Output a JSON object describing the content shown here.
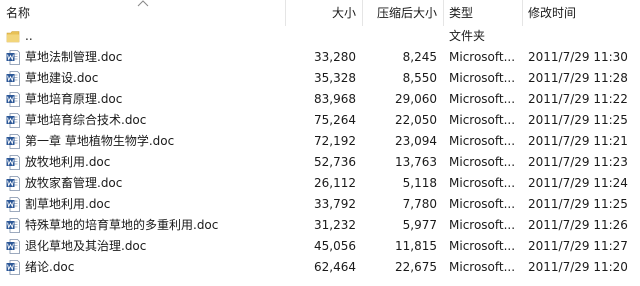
{
  "columns": {
    "name": "名称",
    "size": "大小",
    "compressed": "压缩后大小",
    "type": "类型",
    "modified": "修改时间"
  },
  "parent_row": {
    "name": "..",
    "type": "文件夹",
    "icon": "folder-icon"
  },
  "file_icon": "word-doc-icon",
  "colors": {
    "folder": "#e8c156",
    "word_blue": "#2b5797",
    "separator": "#e5e5e5"
  },
  "files": [
    {
      "name": "草地法制管理.doc",
      "size": "33,280",
      "compressed": "8,245",
      "type": "Microsoft...",
      "modified": "2011/7/29 11:30"
    },
    {
      "name": "草地建设.doc",
      "size": "35,328",
      "compressed": "8,550",
      "type": "Microsoft...",
      "modified": "2011/7/29 11:28"
    },
    {
      "name": "草地培育原理.doc",
      "size": "83,968",
      "compressed": "29,060",
      "type": "Microsoft...",
      "modified": "2011/7/29 11:22"
    },
    {
      "name": "草地培育综合技术.doc",
      "size": "75,264",
      "compressed": "22,050",
      "type": "Microsoft...",
      "modified": "2011/7/29 11:25"
    },
    {
      "name": "第一章 草地植物生物学.doc",
      "size": "72,192",
      "compressed": "23,094",
      "type": "Microsoft...",
      "modified": "2011/7/29 11:21"
    },
    {
      "name": "放牧地利用.doc",
      "size": "52,736",
      "compressed": "13,763",
      "type": "Microsoft...",
      "modified": "2011/7/29 11:23"
    },
    {
      "name": "放牧家畜管理.doc",
      "size": "26,112",
      "compressed": "5,118",
      "type": "Microsoft...",
      "modified": "2011/7/29 11:24"
    },
    {
      "name": "割草地利用.doc",
      "size": "33,792",
      "compressed": "7,780",
      "type": "Microsoft...",
      "modified": "2011/7/29 11:25"
    },
    {
      "name": "特殊草地的培育草地的多重利用.doc",
      "size": "31,232",
      "compressed": "5,977",
      "type": "Microsoft...",
      "modified": "2011/7/29 11:26"
    },
    {
      "name": "退化草地及其治理.doc",
      "size": "45,056",
      "compressed": "11,815",
      "type": "Microsoft...",
      "modified": "2011/7/29 11:27"
    },
    {
      "name": "绪论.doc",
      "size": "62,464",
      "compressed": "22,675",
      "type": "Microsoft...",
      "modified": "2011/7/29 11:20"
    }
  ]
}
